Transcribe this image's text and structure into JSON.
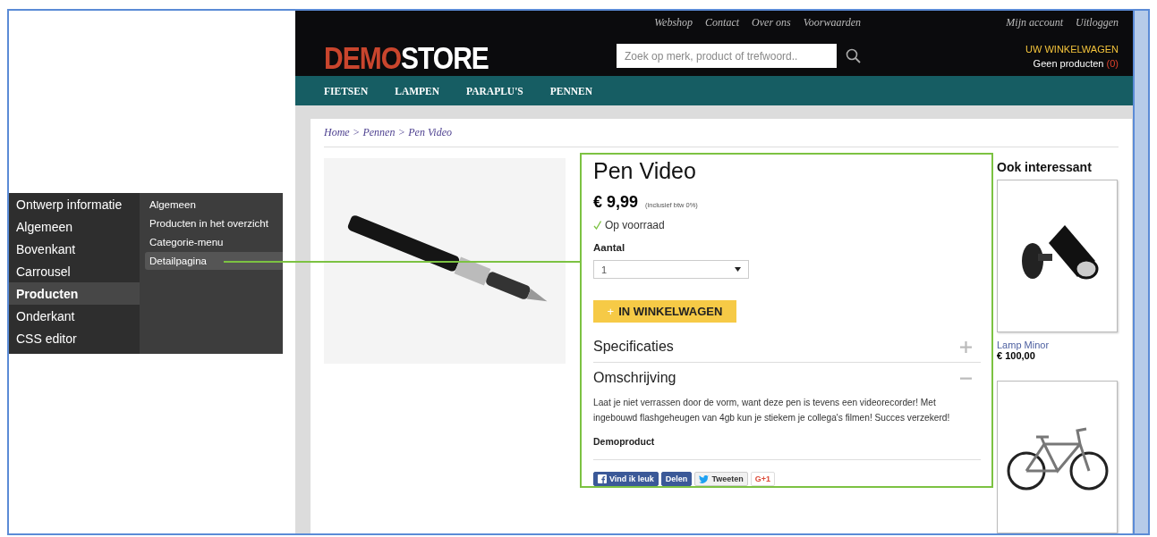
{
  "admin_menu": {
    "items": [
      {
        "label": "Ontwerp informatie",
        "selected": false
      },
      {
        "label": "Algemeen",
        "selected": false
      },
      {
        "label": "Bovenkant",
        "selected": false
      },
      {
        "label": "Carrousel",
        "selected": false
      },
      {
        "label": "Producten",
        "selected": true
      },
      {
        "label": "Onderkant",
        "selected": false
      },
      {
        "label": "CSS editor",
        "selected": false
      }
    ],
    "submenu": [
      {
        "label": "Algemeen",
        "selected": false
      },
      {
        "label": "Producten in het overzicht",
        "selected": false
      },
      {
        "label": "Categorie-menu",
        "selected": false
      },
      {
        "label": "Detailpagina",
        "selected": true
      }
    ]
  },
  "top_links": [
    "Webshop",
    "Contact",
    "Over ons",
    "Voorwaarden"
  ],
  "account_links": [
    "Mijn account",
    "Uitloggen"
  ],
  "logo": {
    "part_1": "DEMO",
    "part_2": "STORE"
  },
  "search": {
    "placeholder": "Zoek op merk, product of trefwoord.."
  },
  "cart": {
    "title": "UW WINKELWAGEN",
    "status": "Geen producten",
    "count": "(0)"
  },
  "nav": [
    "FIETSEN",
    "LAMPEN",
    "PARAPLU'S",
    "PENNEN"
  ],
  "breadcrumb": {
    "items": [
      "Home",
      "Pennen",
      "Pen Video"
    ],
    "separator": ">"
  },
  "product": {
    "highlighted": true,
    "title": "Pen Video",
    "price": "€ 9,99",
    "tax_note": "(inclusief btw 0%)",
    "stock": {
      "in_stock": true,
      "label": "Op voorraad"
    },
    "quantity_label": "Aantal",
    "quantity": "1",
    "add_button": {
      "icon": "+",
      "label": "IN WINKELWAGEN"
    },
    "sections": [
      {
        "title": "Specificaties",
        "expanded": false
      },
      {
        "title": "Omschrijving",
        "expanded": true,
        "text": "Laat je niet verrassen door de vorm, want deze pen is tevens een videorecorder! Met ingebouwd flashgeheugen van 4gb kun je stiekem je collega's filmen! Succes verzekerd!",
        "note": "Demoproduct"
      }
    ]
  },
  "social": [
    {
      "kind": "facebook",
      "label": "Vind ik leuk"
    },
    {
      "kind": "share",
      "label": "Delen"
    },
    {
      "kind": "twitter",
      "label": "Tweeten"
    },
    {
      "kind": "gplus",
      "label": "G+1"
    }
  ],
  "related": {
    "title": "Ook interessant",
    "items": [
      {
        "kind": "lamp",
        "name": "Lamp Minor",
        "price": "€ 100,00"
      },
      {
        "kind": "bicycle"
      }
    ]
  }
}
